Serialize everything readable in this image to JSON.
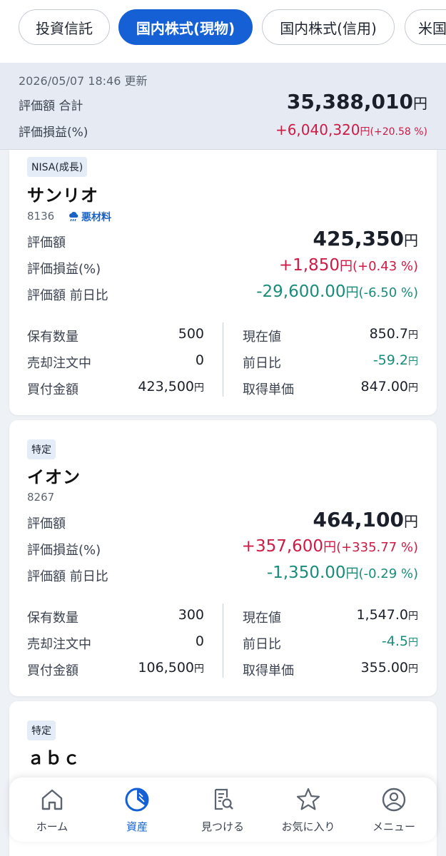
{
  "tabs": [
    {
      "label": "投資信託",
      "active": false
    },
    {
      "label": "国内株式(現物)",
      "active": true
    },
    {
      "label": "国内株式(信用)",
      "active": false
    },
    {
      "label": "米国",
      "active": false
    }
  ],
  "summary": {
    "updated": "2026/05/07 18:46 更新",
    "total_label": "評価額 合計",
    "total_value": "35,388,010",
    "gain_label": "評価損益(%)",
    "gain_value": "+6,040,320",
    "gain_pct": "(+20.58 %)",
    "yen": "円"
  },
  "labels": {
    "valuation": "評価額",
    "gain": "評価損益(%)",
    "day_change": "評価額 前日比",
    "shares": "保有数量",
    "selling": "売却注文中",
    "purchase": "買付金額",
    "price": "現在値",
    "price_change": "前日比",
    "unit_cost": "取得単価",
    "yen": "円"
  },
  "holdings": [
    {
      "account": "NISA(成長)",
      "name": "サンリオ",
      "code": "8136",
      "alert": "悪材料",
      "valuation": "425,350",
      "gain": "+1,850",
      "gain_pct": "(+0.43 %)",
      "day_change": "-29,600.00",
      "day_change_pct": "(-6.50 %)",
      "shares": "500",
      "selling": "0",
      "purchase": "423,500",
      "price": "850.7",
      "price_change": "-59.2",
      "unit_cost": "847.00"
    },
    {
      "account": "特定",
      "name": "イオン",
      "code": "8267",
      "valuation": "464,100",
      "gain": "+357,600",
      "gain_pct": "(+335.77 %)",
      "day_change": "-1,350.00",
      "day_change_pct": "(-0.29 %)",
      "shares": "300",
      "selling": "0",
      "purchase": "106,500",
      "price": "1,547.0",
      "price_change": "-4.5",
      "unit_cost": "355.00"
    },
    {
      "account": "特定",
      "name": "ａｂｃ"
    }
  ],
  "nav": [
    {
      "label": "ホーム",
      "icon": "home-icon",
      "active": false
    },
    {
      "label": "資産",
      "icon": "pie-chart-icon",
      "active": true
    },
    {
      "label": "見つける",
      "icon": "search-document-icon",
      "active": false
    },
    {
      "label": "お気に入り",
      "icon": "star-icon",
      "active": false
    },
    {
      "label": "メニュー",
      "icon": "user-icon",
      "active": false
    }
  ],
  "colors": {
    "accent": "#1560d4",
    "positive": "#cc1b45",
    "negative": "#1a8c7a"
  }
}
